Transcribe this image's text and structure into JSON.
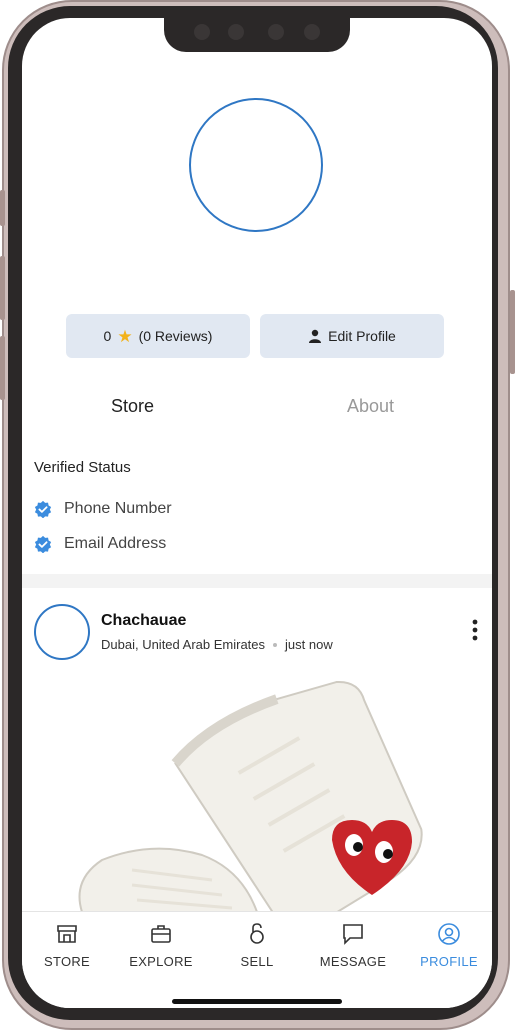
{
  "profile": {
    "rating_value": "0",
    "reviews_label": "(0 Reviews)",
    "edit_profile_label": "Edit Profile"
  },
  "tabs": [
    {
      "label": "Store",
      "active": true
    },
    {
      "label": "About",
      "active": false
    }
  ],
  "verified": {
    "title": "Verified Status",
    "items": [
      "Phone Number",
      "Email Address"
    ]
  },
  "post": {
    "user_name": "Chachauae",
    "location": "Dubai, United Arab Emirates",
    "time": "just now",
    "image_icon": "sneaker-photo"
  },
  "bottom_nav": [
    {
      "label": "STORE",
      "icon": "store-icon",
      "active": false
    },
    {
      "label": "EXPLORE",
      "icon": "briefcase-icon",
      "active": false
    },
    {
      "label": "SELL",
      "icon": "lock-icon",
      "active": false
    },
    {
      "label": "MESSAGE",
      "icon": "message-icon",
      "active": false
    },
    {
      "label": "PROFILE",
      "icon": "profile-icon",
      "active": true
    }
  ],
  "colors": {
    "accent": "#3b8cde",
    "avatar_border": "#2f77c4",
    "button_bg": "#e1e8f2",
    "star": "#f2b21a"
  }
}
